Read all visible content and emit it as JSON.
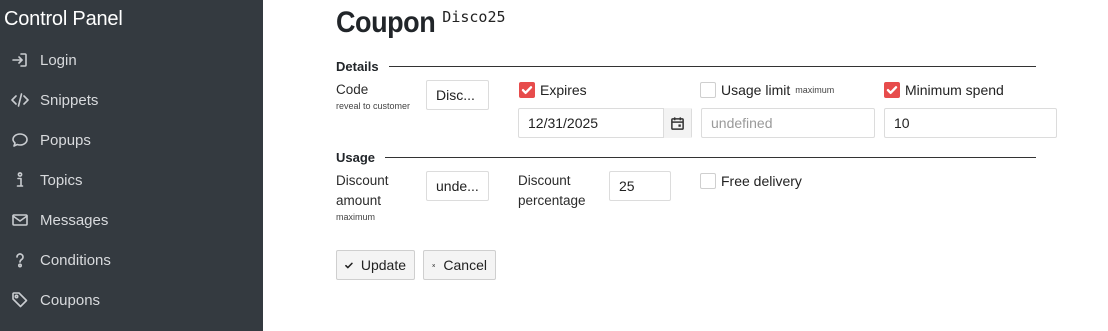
{
  "sidebar": {
    "brand": "Control Panel",
    "items": [
      {
        "label": "Login",
        "icon": "sign-in-icon"
      },
      {
        "label": "Snippets",
        "icon": "code-icon"
      },
      {
        "label": "Popups",
        "icon": "comment-icon"
      },
      {
        "label": "Topics",
        "icon": "info-icon"
      },
      {
        "label": "Messages",
        "icon": "envelope-icon"
      },
      {
        "label": "Conditions",
        "icon": "question-icon"
      },
      {
        "label": "Coupons",
        "icon": "tag-icon"
      }
    ]
  },
  "header": {
    "title": "Coupon",
    "code": "Disco25"
  },
  "details": {
    "heading": "Details",
    "code_label": "Code",
    "code_sublabel": "reveal to customer",
    "code_value": "Disc...",
    "expires_label": "Expires",
    "expires_checked": true,
    "expires_value": "12/31/2025",
    "usage_limit_label": "Usage limit",
    "usage_limit_sublabel": "maximum",
    "usage_limit_checked": false,
    "usage_limit_placeholder": "undefined",
    "min_spend_label": "Minimum spend",
    "min_spend_checked": true,
    "min_spend_value": "10"
  },
  "usage": {
    "heading": "Usage",
    "discount_amount_label_1": "Discount",
    "discount_amount_label_2": "amount",
    "discount_amount_sublabel": "maximum",
    "discount_amount_value": "unde...",
    "discount_percentage_label_1": "Discount",
    "discount_percentage_label_2": "percentage",
    "discount_percentage_value": "25",
    "free_delivery_label": "Free delivery",
    "free_delivery_checked": false
  },
  "actions": {
    "update_label": "Update",
    "cancel_label": "Cancel"
  },
  "colors": {
    "sidebar_bg": "#343a40",
    "check_accent": "#e74c4c"
  }
}
